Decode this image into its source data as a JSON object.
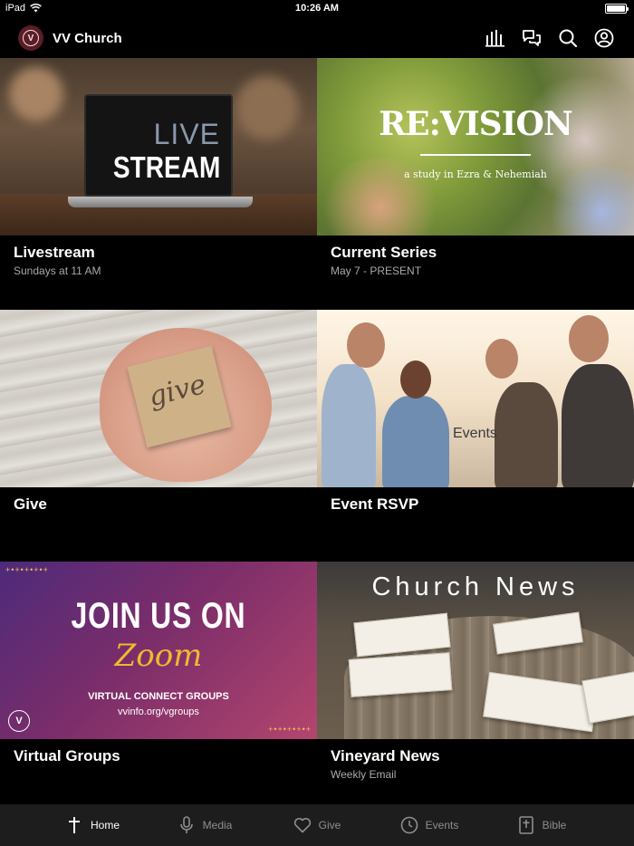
{
  "status_bar": {
    "device": "iPad",
    "time": "10:26 AM"
  },
  "header": {
    "logo_letter": "V",
    "title": "VV Church",
    "icons": [
      "equalizer-icon",
      "chat-icon",
      "search-icon",
      "profile-icon"
    ]
  },
  "tiles": [
    {
      "title": "Livestream",
      "subtitle": "Sundays at 11 AM",
      "image_text": [
        "LIVE",
        "STREAM"
      ]
    },
    {
      "title": "Current Series",
      "subtitle": "May 7 - PRESENT",
      "image_text": [
        "RE:VISION",
        "a study in Ezra & Nehemiah"
      ]
    },
    {
      "title": "Give",
      "subtitle": "",
      "image_text": [
        "give"
      ]
    },
    {
      "title": "Event RSVP",
      "subtitle": "",
      "image_text": [
        "Events"
      ]
    },
    {
      "title": "Virtual Groups",
      "subtitle": "",
      "image_text": [
        "JOIN US ON",
        "Zoom",
        "VIRTUAL CONNECT GROUPS",
        "vvinfo.org/vgroups"
      ]
    },
    {
      "title": "Vineyard News",
      "subtitle": "Weekly Email",
      "image_text": [
        "Church News"
      ]
    }
  ],
  "tabbar": {
    "items": [
      {
        "label": "Home",
        "icon": "cross-icon",
        "active": true
      },
      {
        "label": "Media",
        "icon": "microphone-icon",
        "active": false
      },
      {
        "label": "Give",
        "icon": "heart-icon",
        "active": false
      },
      {
        "label": "Events",
        "icon": "clock-icon",
        "active": false
      },
      {
        "label": "Bible",
        "icon": "bible-icon",
        "active": false
      }
    ]
  },
  "colors": {
    "background": "#000000",
    "tabbar": "#1d1d1d",
    "subtitle": "#a9a9a9",
    "tab_inactive": "#8e8e8e",
    "logo_bg": "#5a1d27"
  }
}
